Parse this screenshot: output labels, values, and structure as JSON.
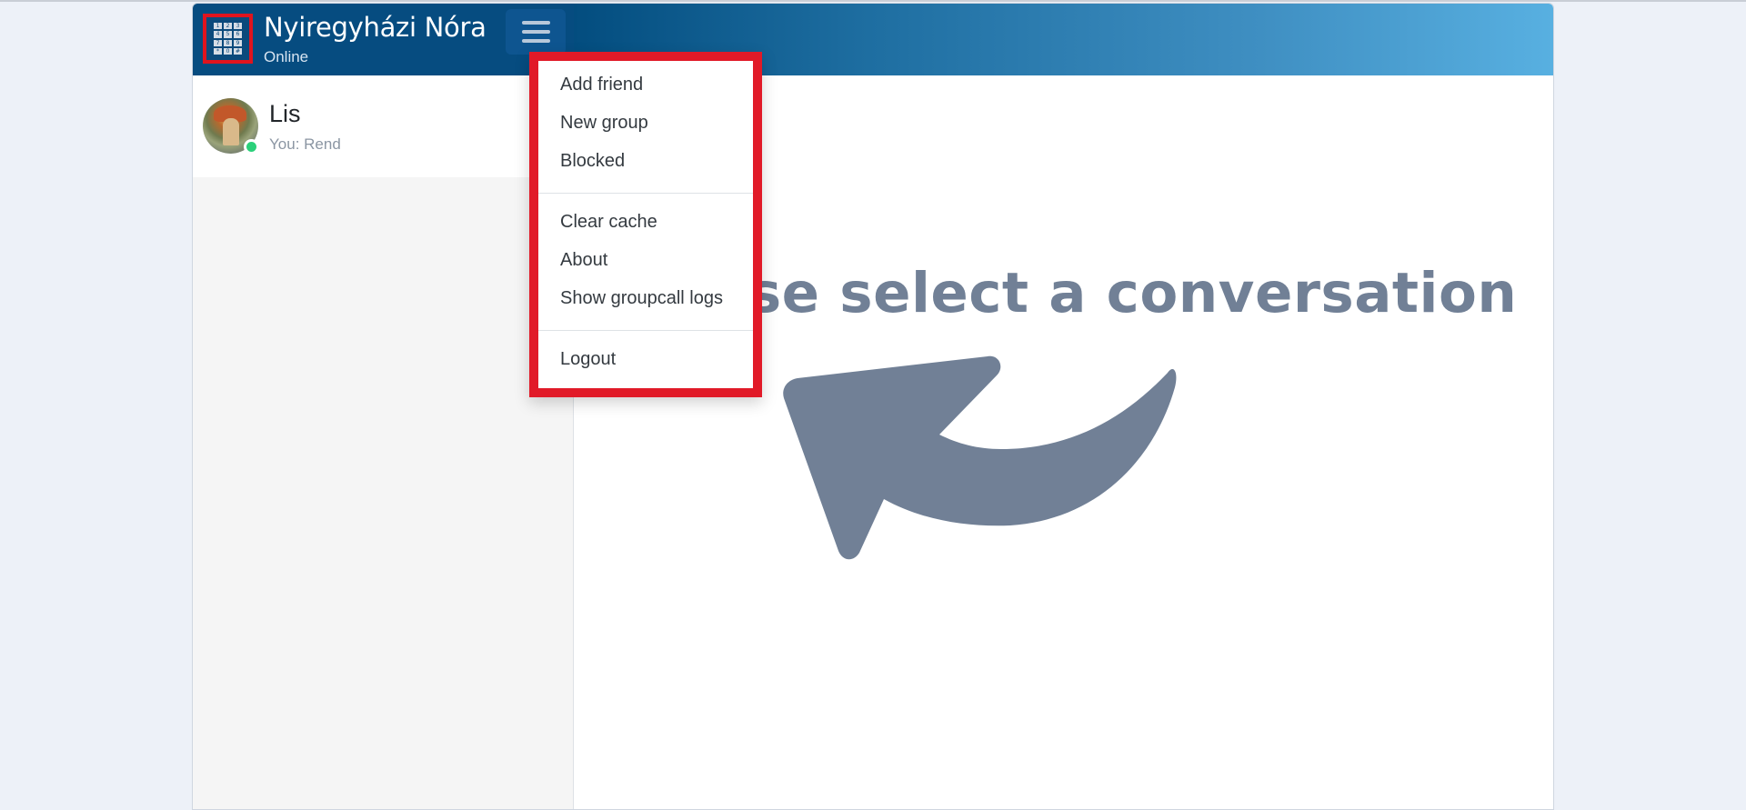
{
  "user": {
    "name": "Nyiregyházi Nóra",
    "status": "Online",
    "logo_keys": [
      "1",
      "2",
      "3",
      "4",
      "5",
      "6",
      "7",
      "8",
      "9",
      "*",
      "0",
      "#"
    ]
  },
  "conversations": [
    {
      "name": "Lis",
      "preview": "You: Rend",
      "online": true
    }
  ],
  "menu": {
    "groups": [
      [
        "Add friend",
        "New group",
        "Blocked"
      ],
      [
        "Clear cache",
        "About",
        "Show groupcall logs"
      ],
      [
        "Logout"
      ]
    ]
  },
  "main": {
    "prompt": "Please select a conversation"
  },
  "colors": {
    "header": "#064c80",
    "highlight": "#e11a28",
    "prompt": "#718096",
    "online": "#2bd07a"
  },
  "icons": {
    "menu": "hamburger-icon",
    "arrow": "curved-arrow-icon"
  }
}
